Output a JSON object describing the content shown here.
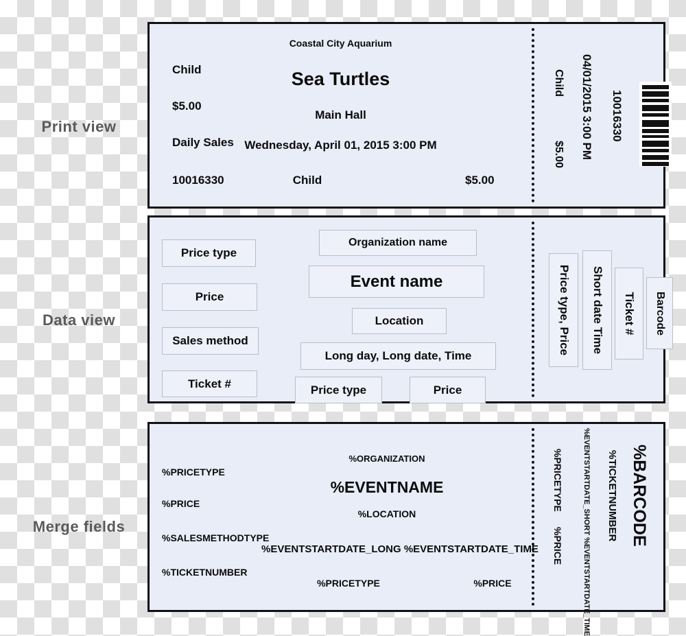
{
  "labels": {
    "print_view": "Print view",
    "data_view": "Data view",
    "merge_fields": "Merge fields"
  },
  "colors": {
    "ticket_fill": "#e8edf8",
    "ticket_border": "#111118",
    "field_border": "#b9bdc7",
    "label_text": "#5a5a5a",
    "text": "#0b0b0b"
  },
  "print_view": {
    "main": {
      "price_type": "Child",
      "price": "$5.00",
      "sales_method": "Daily Sales",
      "ticket_number": "10016330",
      "organization": "Coastal City Aquarium",
      "event_name": "Sea Turtles",
      "location": "Main Hall",
      "long_date": "Wednesday, April 01, 2015 3:00 PM",
      "bottom_price_type": "Child",
      "bottom_price": "$5.00"
    },
    "stub": {
      "price_type": "Child",
      "price": "$5.00",
      "short_date_time": "04/01/2015  3:00 PM",
      "ticket_number": "10016330",
      "barcode": "barcode-image"
    }
  },
  "data_view": {
    "main": {
      "price_type": "Price type",
      "price": "Price",
      "sales_method": "Sales method",
      "ticket_number": "Ticket #",
      "organization": "Organization name",
      "event_name": "Event name",
      "location": "Location",
      "long_date": "Long day, Long date, Time",
      "bottom_price_type": "Price type",
      "bottom_price": "Price"
    },
    "stub": {
      "price_type_price": "Price type, Price",
      "short_date_time": "Short date Time",
      "ticket_number": "Ticket #",
      "barcode": "Barcode"
    }
  },
  "merge_fields": {
    "main": {
      "price_type": "%PRICETYPE",
      "price": "%PRICE",
      "sales_method": "%SALESMETHODTYPE",
      "ticket_number": "%TICKETNUMBER",
      "organization": "%ORGANIZATION",
      "event_name": "%EVENTNAME",
      "location": "%LOCATION",
      "long_date": "%EVENTSTARTDATE_LONG %EVENTSTARTDATE_TIME",
      "bottom_price_type": "%PRICETYPE",
      "bottom_price": "%PRICE"
    },
    "stub": {
      "price_type": "%PRICETYPE",
      "price": "%PRICE",
      "short_date_time": "%EVENTSTARTDATE_SHORT %EVENTSTARTDATE_TIME",
      "ticket_number": "%TICKETNUMBER",
      "barcode": "%BARCODE"
    }
  }
}
